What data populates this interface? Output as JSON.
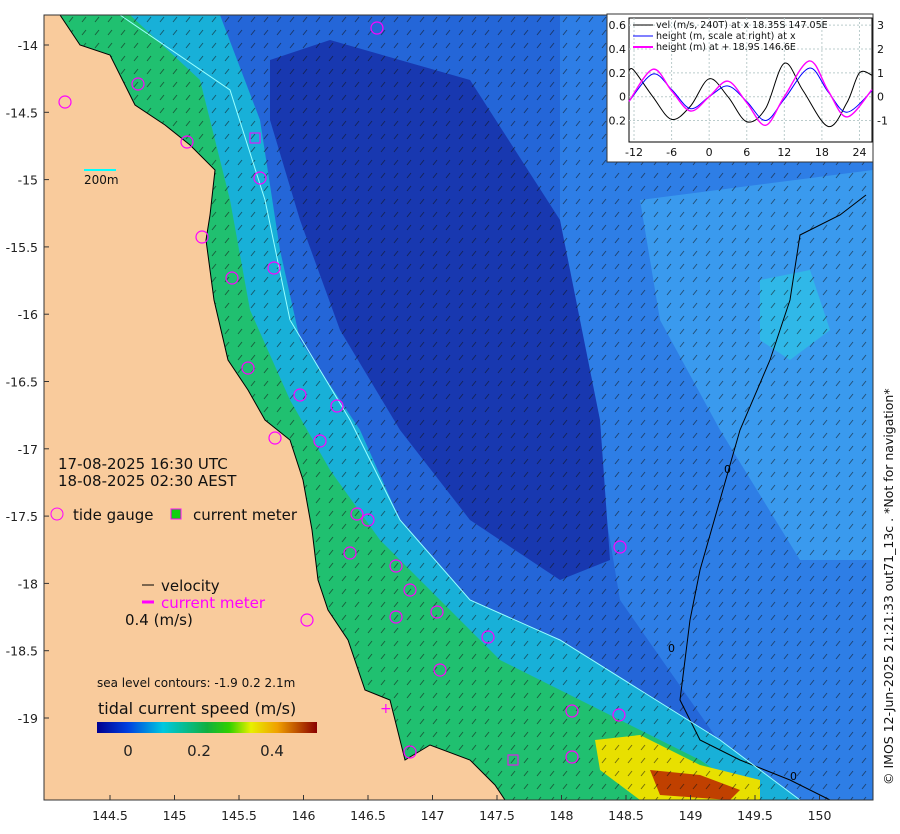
{
  "map": {
    "lon_ticks": [
      "144.5",
      "145",
      "145.5",
      "146",
      "146.5",
      "147",
      "147.5",
      "148",
      "148.5",
      "149",
      "149.5",
      "150"
    ],
    "lat_ticks": [
      "-14",
      "-14.5",
      "-15",
      "-15.5",
      "-16",
      "-16.5",
      "-17",
      "-17.5",
      "-18",
      "-18.5",
      "-19"
    ],
    "scale_bar_label": "200m",
    "contour_labels": [
      "0",
      "0",
      "0",
      "0"
    ],
    "colors": {
      "land": "#F9CB9C",
      "deep": "#1838B0",
      "ocean": "#2466D8",
      "shelf": "#18B8D0",
      "reef": "#20C060",
      "gauge": "#FF00FF"
    }
  },
  "annotations": {
    "time_utc": "17-08-2025 16:30 UTC",
    "time_aest": "18-08-2025 02:30 AEST",
    "tide_gauge_label": "tide gauge",
    "current_meter_label": "current meter",
    "velocity_label": "velocity",
    "current_meter_arrow_label": "current meter",
    "arrow_scale_label": "0.4 (m/s)",
    "contours_label": "sea level contours: -1.9 0.2 2.1m",
    "colorbar_title": "tidal current speed (m/s)",
    "colorbar_ticks": [
      "0",
      "0.2",
      "0.4"
    ],
    "credit": "© IMOS 12-Jun-2025 21:21:33 out71_13c . *Not for navigation*"
  },
  "chart_data": {
    "type": "line",
    "x_ticks": [
      "-12",
      "-6",
      "0",
      "6",
      "12",
      "18",
      "24"
    ],
    "y_left_ticks": [
      "0.6",
      "0.4",
      "0.2",
      "0",
      "0.2"
    ],
    "y_right_ticks": [
      "3",
      "2",
      "1",
      "0",
      "-1"
    ],
    "xlim": [
      -12.8,
      26
    ],
    "ylim_left": [
      -0.38,
      0.66
    ],
    "ylim_right": [
      -1.9,
      3.3
    ],
    "grid": true,
    "legend": "top",
    "series": [
      {
        "name": "vel (m/s, 240T) at x 18.35S 147.05E",
        "axis": "left",
        "color": "#000000",
        "x": [
          -12.8,
          -12,
          -9,
          -6,
          -3,
          0,
          3,
          6,
          9,
          12,
          15,
          19,
          22,
          24,
          26
        ],
        "y": [
          0.22,
          0.22,
          0.0,
          -0.19,
          -0.08,
          0.15,
          0.0,
          -0.21,
          -0.1,
          0.28,
          0.05,
          -0.25,
          -0.05,
          0.2,
          0.18
        ]
      },
      {
        "name": "height (m, scale at right) at x",
        "axis": "right",
        "color": "#0000FF",
        "x": [
          -12.8,
          -9,
          -6,
          -3,
          0,
          3,
          6,
          9,
          12,
          16,
          19,
          22,
          26
        ],
        "y": [
          -0.2,
          0.95,
          0.3,
          -0.5,
          0.0,
          0.45,
          -0.2,
          -1.0,
          -0.1,
          1.2,
          0.2,
          -0.65,
          0.25
        ]
      },
      {
        "name": "height (m) at + 18.9S 146.6E",
        "axis": "left",
        "color": "#FF00FF",
        "x": [
          -12.8,
          -9,
          -6,
          -3,
          0,
          3,
          6,
          9,
          12,
          16,
          19,
          22,
          26
        ],
        "y": [
          -0.04,
          0.23,
          0.05,
          -0.12,
          0.0,
          0.13,
          -0.05,
          -0.24,
          0.0,
          0.3,
          0.05,
          -0.17,
          0.06
        ]
      }
    ]
  }
}
